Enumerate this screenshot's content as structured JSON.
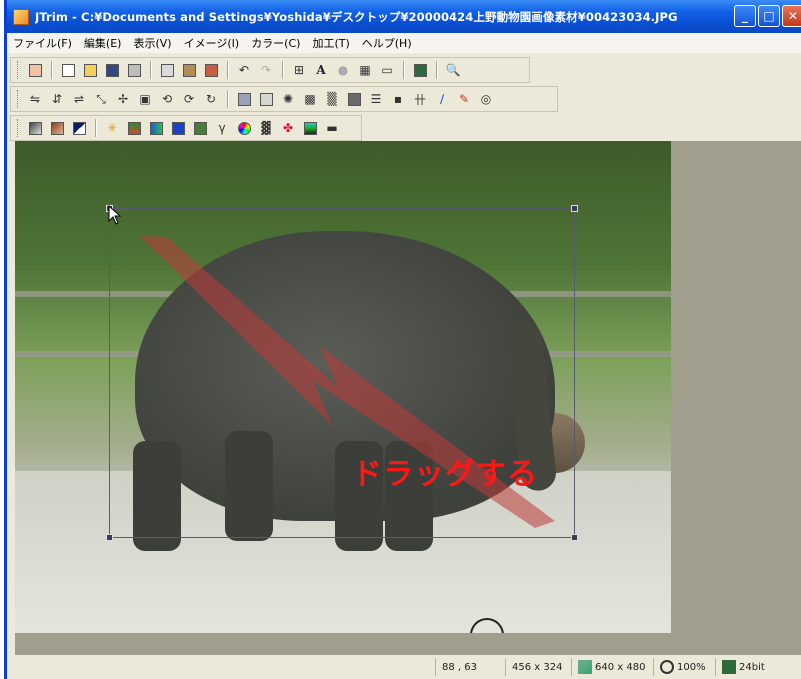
{
  "window": {
    "title": "JTrim - C:¥Documents and Settings¥Yoshida¥デスクトップ¥20000424上野動物園画像素材¥00423034.JPG",
    "buttons": {
      "minimize": "_",
      "maximize": "□",
      "close": "✕"
    }
  },
  "menu": [
    "ファイル(F)",
    "編集(E)",
    "表示(V)",
    "イメージ(I)",
    "カラー(C)",
    "加工(T)",
    "ヘルプ(H)"
  ],
  "canvas": {
    "overlay_text": "ドラッグする"
  },
  "status": {
    "cursor_pos": "88 , 63",
    "selection_size": "456 x 324",
    "image_size": "640 x 480",
    "zoom": "100%",
    "color_depth": "24bit"
  },
  "colors": {
    "titlebar": "#0a4fd3",
    "overlay_text": "#ff1717",
    "arrow": "#c03a3a"
  },
  "toolbar1_icons": [
    "new-window-icon",
    "new-icon",
    "open-icon",
    "save-icon",
    "print-icon",
    "copy-icon",
    "paste-icon",
    "paste-new-icon",
    "undo-icon",
    "redo-icon",
    "fit-icon",
    "text-icon",
    "circle-icon",
    "grid-icon",
    "panel-icon",
    "color-icon",
    "zoom-icon"
  ],
  "toolbar2_icons": [
    "flip-h-icon",
    "flip-v-icon",
    "mirror-icon",
    "resize-icon",
    "move-icon",
    "frame-icon",
    "rotate-left-icon",
    "rotate-right-icon",
    "rotate-icon",
    "image-icon",
    "rect-icon",
    "sun-icon",
    "mosaic-icon",
    "noise-icon",
    "sharpen-icon",
    "blur-icon",
    "emboss-icon",
    "grid2-icon",
    "pen-icon",
    "brush-icon",
    "spiral-icon"
  ],
  "toolbar3_icons": [
    "gray-icon",
    "sepia-icon",
    "invert-icon",
    "sparkle-icon",
    "tone-icon",
    "gradient-icon",
    "blue-icon",
    "picture-icon",
    "gamma-icon",
    "palette-icon",
    "dither-icon",
    "colors-icon",
    "rgb-icon",
    "bar-icon"
  ]
}
